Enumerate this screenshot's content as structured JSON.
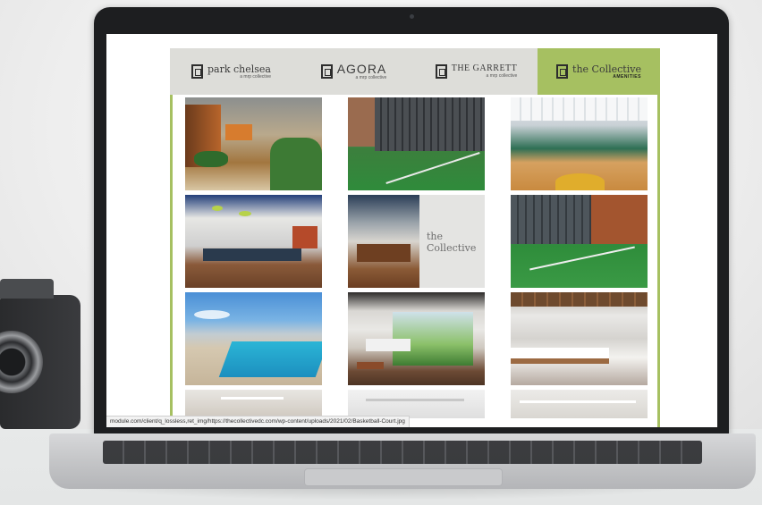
{
  "nav": {
    "items": [
      {
        "main": "park chelsea",
        "sub": "a mrp collective",
        "style": "serif",
        "active": false
      },
      {
        "main": "AGORA",
        "sub": "a mrp collective",
        "style": "caps",
        "active": false
      },
      {
        "main": "THE GARRETT",
        "sub": "a mrp collective",
        "style": "serifcaps",
        "active": false
      },
      {
        "main": "the Collective",
        "sub": "AMENITIES",
        "style": "serif",
        "active": true
      }
    ]
  },
  "gallery": {
    "images": [
      {
        "name": "photo-atrium-lounge"
      },
      {
        "name": "photo-outdoor-sport-court"
      },
      {
        "name": "photo-indoor-basketball-court"
      },
      {
        "name": "photo-clubroom-bar"
      },
      {
        "name": "photo-collective-lobby"
      },
      {
        "name": "photo-tennis-court"
      },
      {
        "name": "photo-rooftop-pool"
      },
      {
        "name": "photo-golf-simulator"
      },
      {
        "name": "photo-kitchen-lounge"
      },
      {
        "name": "photo-partial-1"
      },
      {
        "name": "photo-partial-2"
      },
      {
        "name": "photo-partial-3"
      }
    ]
  },
  "status_bar": {
    "url": "module.com/client/q_lossless,ret_img/https://thecollectivedc.com/wp-content/uploads/2021/02/Basketball-Court.jpg"
  },
  "colors": {
    "accent": "#a6c061",
    "nav_background": "#ddddd9"
  }
}
